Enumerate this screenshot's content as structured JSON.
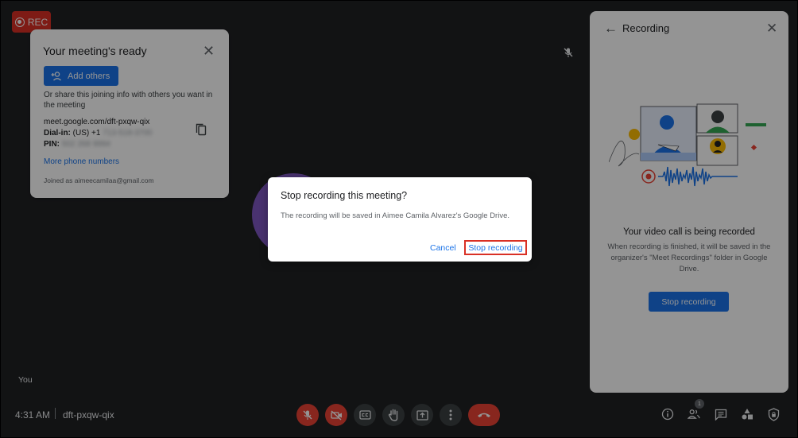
{
  "recording_badge": {
    "label": "REC",
    "icon": "record-icon"
  },
  "ready_card": {
    "title": "Your meeting's ready",
    "add_button": "Add others",
    "share_text": "Or share this joining info with others you want in the meeting",
    "link": "meet.google.com/dft-pxqw-qix",
    "dial_in_label": "Dial-in:",
    "dial_in_value": "(US) +1",
    "dial_in_hidden": "713-518-3700",
    "pin_label": "PIN:",
    "pin_hidden": "502 268 9994",
    "more_phones": "More phone numbers",
    "joined_as": "Joined as aimeecamilaa@gmail.com"
  },
  "participant": {
    "name": "You"
  },
  "side_panel": {
    "title": "Recording",
    "heading": "Your video call is being recorded",
    "description": "When recording is finished, it will be saved in the organizer's \"Meet Recordings\" folder in Google Drive.",
    "stop_button": "Stop recording"
  },
  "dialog": {
    "title": "Stop recording this meeting?",
    "body": "The recording will be saved in Aimee Camila Alvarez's Google Drive.",
    "cancel": "Cancel",
    "confirm": "Stop recording"
  },
  "bottom_bar": {
    "time": "4:31 AM",
    "meeting_code": "dft-pxqw-qix",
    "people_count": "1"
  },
  "colors": {
    "background": "#202124",
    "accent": "#1a73e8",
    "danger": "#ea4335",
    "avatar": "#7e57c2"
  }
}
